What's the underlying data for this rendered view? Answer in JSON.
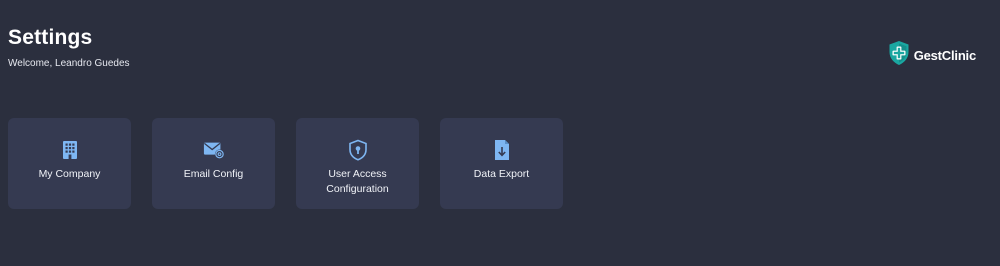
{
  "header": {
    "title": "Settings",
    "welcome": "Welcome, Leandro Guedes"
  },
  "brand": {
    "name": "GestClinic",
    "logo_icon": "shield-cross-icon",
    "accent": "#1aa7a1"
  },
  "cards": [
    {
      "label": "My Company",
      "icon": "building-icon"
    },
    {
      "label": "Email Config",
      "icon": "envelope-at-icon"
    },
    {
      "label": "User Access Configuration",
      "icon": "shield-lock-icon"
    },
    {
      "label": "Data Export",
      "icon": "file-download-icon"
    }
  ],
  "colors": {
    "background": "#2b2f3e",
    "card": "#353a51",
    "icon": "#7eb6f2"
  }
}
